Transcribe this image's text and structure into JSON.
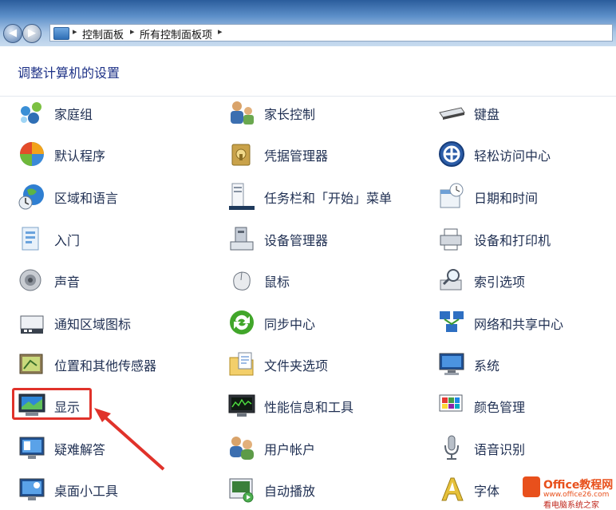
{
  "window": {
    "breadcrumb": [
      "控制面板",
      "所有控制面板项"
    ]
  },
  "page_title": "调整计算机的设置",
  "items": [
    {
      "label": "家庭组",
      "icon": "homegroup-icon"
    },
    {
      "label": "家长控制",
      "icon": "parental-controls-icon"
    },
    {
      "label": "键盘",
      "icon": "keyboard-icon"
    },
    {
      "label": "默认程序",
      "icon": "default-programs-icon"
    },
    {
      "label": "凭据管理器",
      "icon": "credential-manager-icon"
    },
    {
      "label": "轻松访问中心",
      "icon": "ease-of-access-icon"
    },
    {
      "label": "区域和语言",
      "icon": "region-language-icon"
    },
    {
      "label": "任务栏和「开始」菜单",
      "icon": "taskbar-start-menu-icon"
    },
    {
      "label": "日期和时间",
      "icon": "date-time-icon"
    },
    {
      "label": "入门",
      "icon": "getting-started-icon"
    },
    {
      "label": "设备管理器",
      "icon": "device-manager-icon"
    },
    {
      "label": "设备和打印机",
      "icon": "devices-printers-icon"
    },
    {
      "label": "声音",
      "icon": "sound-icon"
    },
    {
      "label": "鼠标",
      "icon": "mouse-icon"
    },
    {
      "label": "索引选项",
      "icon": "indexing-options-icon"
    },
    {
      "label": "通知区域图标",
      "icon": "notification-area-icon"
    },
    {
      "label": "同步中心",
      "icon": "sync-center-icon"
    },
    {
      "label": "网络和共享中心",
      "icon": "network-sharing-icon"
    },
    {
      "label": "位置和其他传感器",
      "icon": "location-sensors-icon"
    },
    {
      "label": "文件夹选项",
      "icon": "folder-options-icon"
    },
    {
      "label": "系统",
      "icon": "system-icon"
    },
    {
      "label": "显示",
      "icon": "display-icon"
    },
    {
      "label": "性能信息和工具",
      "icon": "performance-icon"
    },
    {
      "label": "颜色管理",
      "icon": "color-management-icon"
    },
    {
      "label": "疑难解答",
      "icon": "troubleshooting-icon"
    },
    {
      "label": "用户帐户",
      "icon": "user-accounts-icon"
    },
    {
      "label": "语音识别",
      "icon": "speech-recognition-icon"
    },
    {
      "label": "桌面小工具",
      "icon": "desktop-gadgets-icon"
    },
    {
      "label": "自动播放",
      "icon": "autoplay-icon"
    },
    {
      "label": "字体",
      "icon": "fonts-icon"
    }
  ],
  "annotation": {
    "highlighted_item": "显示",
    "color": "#e0322a"
  },
  "watermark": {
    "brand": "Office教程网",
    "site": "www.office26.com",
    "tagline": "看电脑系统之家"
  }
}
